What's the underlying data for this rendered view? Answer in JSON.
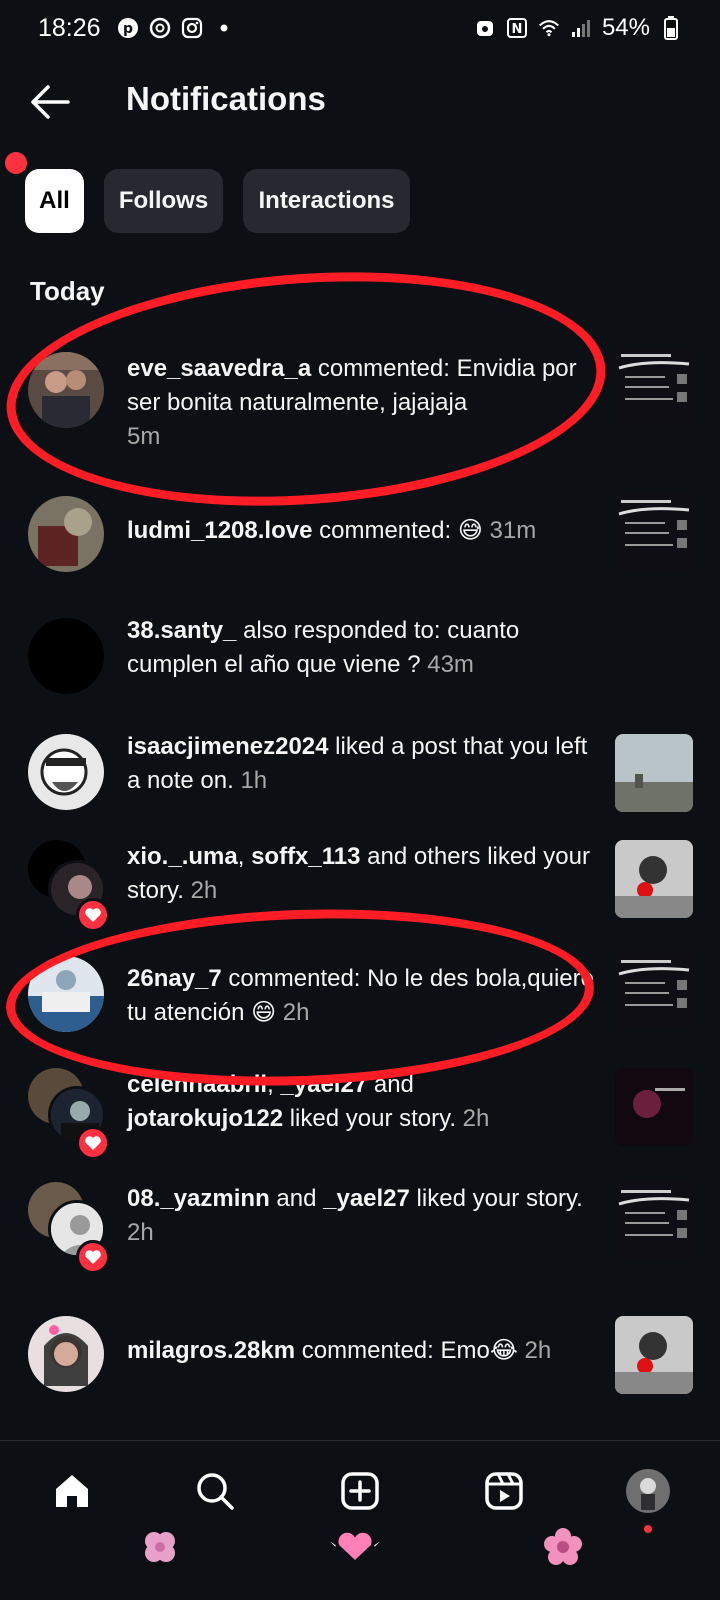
{
  "status_bar": {
    "time": "18:26",
    "battery": "54%"
  },
  "header": {
    "title": "Notifications"
  },
  "filters": [
    {
      "label": "All",
      "active": true
    },
    {
      "label": "Follows",
      "active": false
    },
    {
      "label": "Interactions",
      "active": false
    }
  ],
  "section": {
    "label": "Today"
  },
  "notifications": [
    {
      "user": "eve_saavedra_a",
      "text": " commented: Envidia por ser bonita naturalmente, jajajaja ",
      "time": "5m"
    },
    {
      "user": "ludmi_1208.love",
      "text": " commented: 😅 ",
      "time": "31m"
    },
    {
      "user": "38.santy_",
      "text": " also responded to: cuanto cumplen el año que viene ? ",
      "time": "43m"
    },
    {
      "user": "isaacjimenez2024",
      "text": " liked a post that you left a note on. ",
      "time": "1h"
    },
    {
      "user": "xio._.uma",
      "sep": ", ",
      "user2": "soffx_113",
      "text": " and others liked your story. ",
      "time": "2h"
    },
    {
      "user": "26nay_7",
      "text": " commented: No le des bola,quiere tu atención 😄 ",
      "time": "2h"
    },
    {
      "user": "celennaabril",
      "sep": ", ",
      "user2": "_yael27",
      "sep2": " and ",
      "user3": "jotarokujo122",
      "text": " liked your story. ",
      "time": "2h"
    },
    {
      "user": "08._yazminn",
      "sep": " and ",
      "user2": "_yael27",
      "text": " liked your story. ",
      "time": "2h"
    },
    {
      "user": "milagros.28km",
      "text": " commented: Emo😂 ",
      "time": "2h"
    }
  ],
  "nav_icons": [
    "home-icon",
    "search-icon",
    "create-icon",
    "reels-icon",
    "profile-avatar"
  ],
  "colors": {
    "background": "#0c1015",
    "chip": "#262a30",
    "accent_red": "#ff3040",
    "annotation_red": "#ff1d25"
  }
}
